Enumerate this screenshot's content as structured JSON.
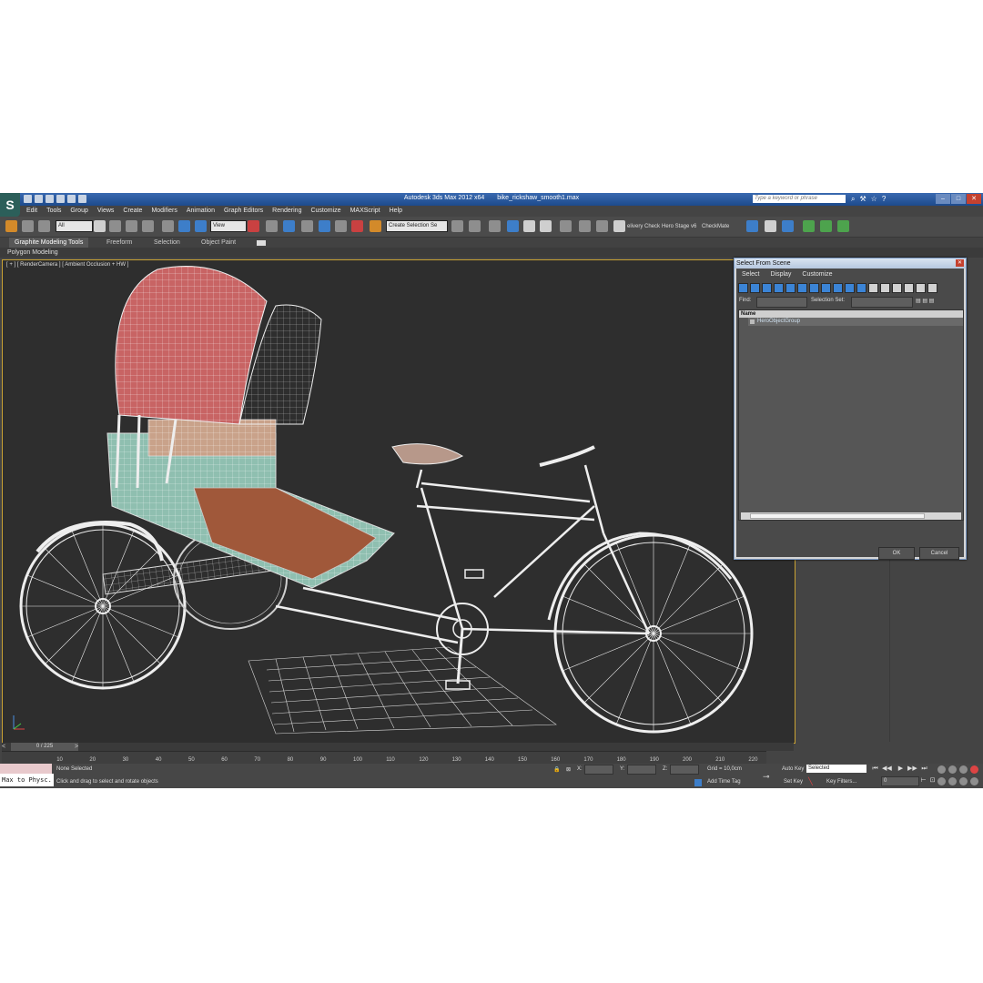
{
  "window": {
    "app_title": "Autodesk 3ds Max  2012 x64",
    "file_name": "bike_rickshaw_smooth1.max",
    "search_placeholder": "Type a keyword or phrase",
    "controls": [
      "–",
      "□",
      "✕"
    ]
  },
  "menu": [
    "Edit",
    "Tools",
    "Group",
    "Views",
    "Create",
    "Modifiers",
    "Animation",
    "Graph Editors",
    "Rendering",
    "Customize",
    "MAXScript",
    "Help"
  ],
  "toolbar": {
    "selection_filter": "All",
    "ref_coord": "View",
    "named_selection": "Create Selection Se",
    "script_buttons": [
      "elivery Check",
      "Hero Stage v6",
      "CheckMate"
    ]
  },
  "ribbon": {
    "tabs": [
      "Graphite Modeling Tools",
      "Freeform",
      "Selection",
      "Object Paint"
    ],
    "sub_label": "Polygon Modeling"
  },
  "viewport": {
    "label": "[ + ] [ RenderCamera ] [ Ambient Occlusion + HW ]"
  },
  "dialog": {
    "title": "Select From Scene",
    "menu": [
      "Select",
      "Display",
      "Customize"
    ],
    "find_label": "Find:",
    "selection_set_label": "Selection Set:",
    "column_header": "Name",
    "items": [
      "HeroObjectGroup"
    ],
    "ok_label": "OK",
    "cancel_label": "Cancel"
  },
  "timeline": {
    "frame_display": "0 / 225",
    "ticks": [
      "0",
      "10",
      "20",
      "30",
      "40",
      "50",
      "60",
      "70",
      "80",
      "90",
      "100",
      "110",
      "120",
      "130",
      "140",
      "150",
      "160",
      "170",
      "180",
      "190",
      "200",
      "210",
      "220"
    ]
  },
  "status": {
    "script_listener": "Max to Physc.",
    "selection_status": "None Selected",
    "prompt": "Click and drag to select and rotate objects",
    "x_label": "X:",
    "y_label": "Y:",
    "z_label": "Z:",
    "grid": "Grid = 10,0cm",
    "add_time_tag": "Add Time Tag",
    "auto_key": "Auto Key",
    "set_key": "Set Key",
    "key_mode": "Selected",
    "key_filters": "Key Filters...",
    "current_frame": "0"
  },
  "colors": {
    "title_bar": "#1d4a8c",
    "ui_background": "#444444",
    "viewport_background": "#2e2e2e",
    "viewport_border": "#c9a233",
    "canopy": "#c86464",
    "seat_body": "#8fbfb0",
    "wood_floor": "#a0583a"
  }
}
